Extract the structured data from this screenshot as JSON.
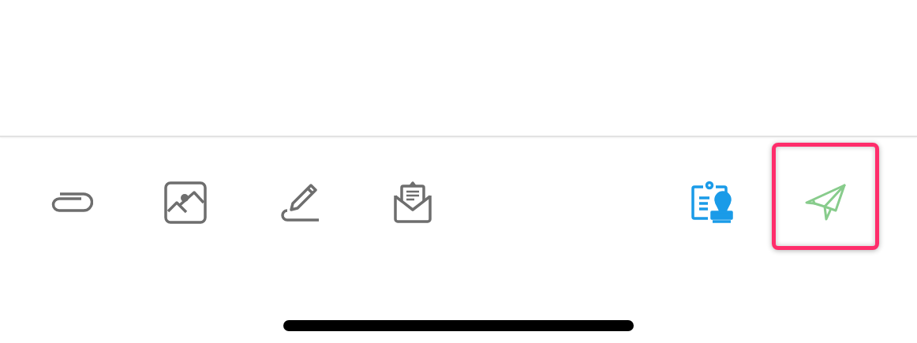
{
  "toolbar": {
    "left_buttons": [
      {
        "kind": "attachment",
        "highlighted": false
      },
      {
        "kind": "image",
        "highlighted": false
      },
      {
        "kind": "signature",
        "highlighted": false
      },
      {
        "kind": "letter",
        "highlighted": false
      }
    ],
    "right_buttons": [
      {
        "kind": "stamp",
        "highlighted": false
      },
      {
        "kind": "send",
        "highlighted": true
      }
    ]
  }
}
